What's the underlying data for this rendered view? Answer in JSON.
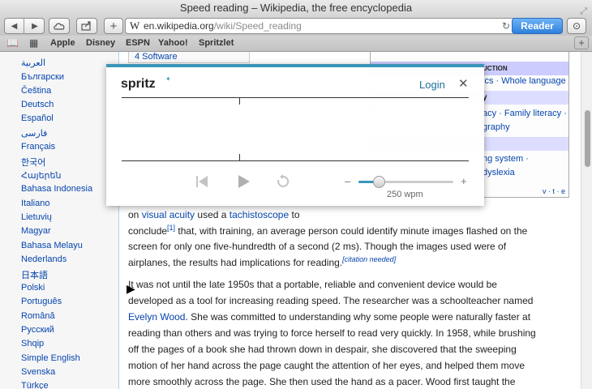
{
  "window": {
    "title": "Speed reading – Wikipedia, the free encyclopedia"
  },
  "toolbar": {
    "url_host": "en.wikipedia.org",
    "url_path": "/wiki/Speed_reading",
    "reader_label": "Reader"
  },
  "bookmarks": [
    "Apple",
    "Disney",
    "ESPN",
    "Yahoo!",
    "Spritzlet"
  ],
  "languages": [
    "العربية",
    "Български",
    "Čeština",
    "Deutsch",
    "Español",
    "فارسی",
    "Français",
    "한국어",
    "Հայերեն",
    "Bahasa Indonesia",
    "Italiano",
    "Lietuvių",
    "Magyar",
    "Bahasa Melayu",
    "Nederlands",
    "日本語",
    "Polski",
    "Português",
    "Română",
    "Русский",
    "Shqip",
    "Simple English",
    "Svenska",
    "Türkçe"
  ],
  "toc": {
    "item": "4 Software"
  },
  "navbox": {
    "header": "UCTION",
    "row1": "ics · Whole language",
    "group1": "y",
    "row2": "acy · Family literacy ·",
    "row3": "graphy",
    "row4": "ng system ·",
    "row5": "dyslexia",
    "vte": "v · t · e"
  },
  "article": {
    "p1": {
      "l1_a": "on ",
      "l1_link1": "visual acuity",
      "l1_b": " used a ",
      "l1_link2": "tachistoscope",
      "l1_c": " to",
      "l2_a": "conclude",
      "l2_sup": "[1]",
      "l2_b": " that, with training, an average person could identify minute images flashed on the",
      "l3": "screen for only one five-hundredth of a second (2 ms). Though the images used were of",
      "l4_a": "airplanes, the results had implications for reading.",
      "l4_cite": "[citation needed]"
    },
    "p2": {
      "l1": "It was not until the late 1950s that a portable, reliable and convenient device would be",
      "l2": "developed as a tool for increasing reading speed. The researcher was a schoolteacher named",
      "l3_link": "Evelyn Wood",
      "l3_b": ". She was committed to understanding why some people were naturally faster at",
      "l4": "reading than others and was trying to force herself to read very quickly. In 1958, while brushing",
      "l5": "off the pages of a book she had thrown down in despair, she discovered that the sweeping",
      "l6": "motion of her hand across the page caught the attention of her eyes, and helped them move",
      "l7": "more smoothly across the page. She then used the hand as a pacer. Wood first taught the"
    }
  },
  "spritz": {
    "logo": "spritz",
    "login": "Login",
    "close": "✕",
    "wpm_label": "250 wpm",
    "speed_fraction": 0.21,
    "accent": "#3a95b8"
  }
}
